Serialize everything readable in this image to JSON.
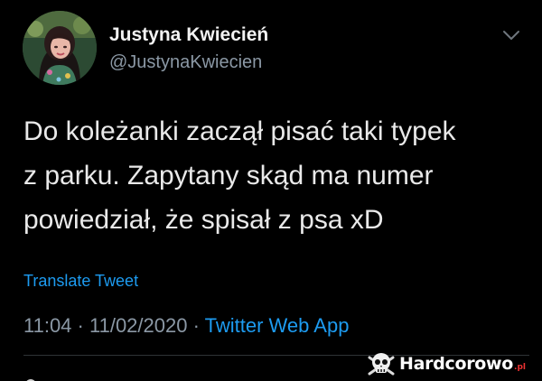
{
  "author": {
    "display_name": "Justyna Kwiecień",
    "handle": "@JustynaKwiecien",
    "avatar_icon": "profile-avatar"
  },
  "menu_icon": "chevron-down-icon",
  "tweet": {
    "lines": [
      "Do koleżanki zaczął pisać taki typek",
      "z parku. Zapytany skąd ma numer",
      "powiedział, że spisał z psa xD"
    ]
  },
  "translate_label": "Translate Tweet",
  "meta": {
    "time": "11:04",
    "separator": "·",
    "date": "11/02/2020",
    "source": "Twitter Web App"
  },
  "watermark": {
    "text": "Hardcorowo",
    "tld": ".pl"
  },
  "colors": {
    "background": "#000000",
    "accent": "#1d9bf0",
    "muted": "#8b98a5",
    "text": "#e9e9e9"
  }
}
